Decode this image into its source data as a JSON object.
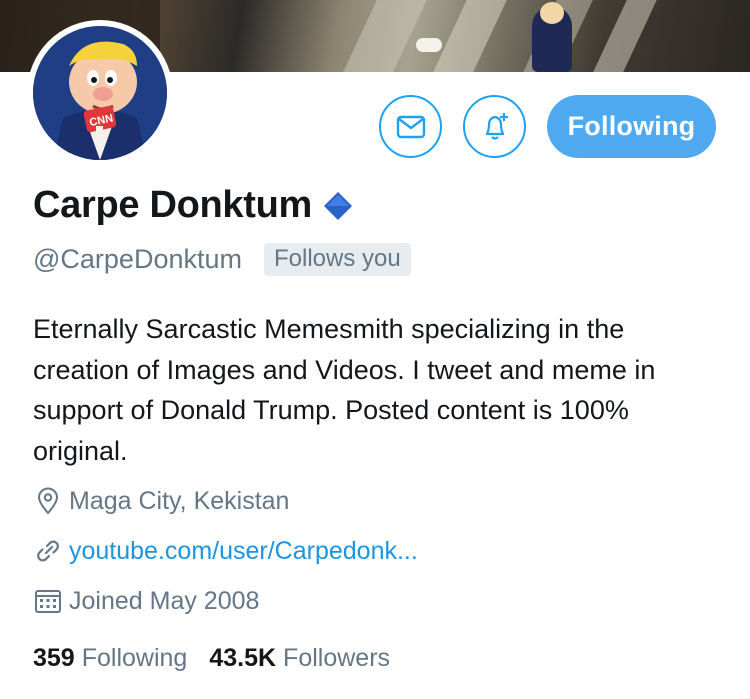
{
  "profile": {
    "name": "Carpe Donktum",
    "handle": "@CarpeDonktum",
    "follows_you": "Follows you",
    "bio": "Eternally Sarcastic Memesmith specializing in the creation of Images and Videos. I tweet and meme in support of Donald Trump. Posted content is 100% original.",
    "location": "Maga City, Kekistan",
    "website": "youtube.com/user/Carpedonk...",
    "joined": "Joined May 2008",
    "avatar_logo_text": "CNN"
  },
  "actions": {
    "following_label": "Following"
  },
  "stats": {
    "following_count": "359",
    "following_label": "Following",
    "followers_count": "43.5K",
    "followers_label": "Followers"
  },
  "icons": {
    "message": "envelope-icon",
    "notifications": "bell-plus-icon",
    "verified": "blue-diamond-icon",
    "location": "location-pin-icon",
    "link": "link-icon",
    "joined": "calendar-icon"
  },
  "colors": {
    "accent": "#1da1f2",
    "following_button": "#4fa9f0",
    "secondary_text": "#657786",
    "link": "#1b95e0",
    "verified": "#2a62c9"
  }
}
